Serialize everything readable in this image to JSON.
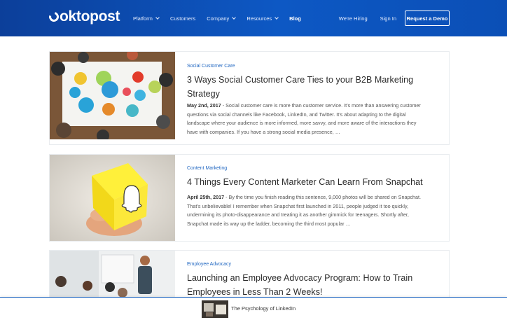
{
  "header": {
    "brand": "oktopost",
    "nav": [
      {
        "label": "Platform",
        "dropdown": true
      },
      {
        "label": "Customers",
        "dropdown": false
      },
      {
        "label": "Company",
        "dropdown": true
      },
      {
        "label": "Resources",
        "dropdown": true
      },
      {
        "label": "Blog",
        "dropdown": false,
        "active": true
      }
    ],
    "hiring": "We're Hiring",
    "sign_in": "Sign In",
    "demo": "Request a Demo"
  },
  "posts": [
    {
      "category": "Social Customer Care",
      "title_line1": "3 Ways Social Customer Care Ties to your B2B Marketing",
      "title_line2": "Strategy",
      "date": "May 2nd, 2017",
      "excerpt_l1": " - Social customer care is more than customer service. It’s more than answering customer",
      "excerpt_l2": "questions via social channels like Facebook, LinkedIn, and Twitter. It’s about adapting to the digital",
      "excerpt_l3": "landscape where your audience is more informed, more savvy, and more aware of the interactions they",
      "excerpt_l4": "have with companies. If you have a strong social media presence, …"
    },
    {
      "category": "Content Marketing",
      "title_line1": "4 Things Every Content Marketer Can Learn From Snapchat",
      "date": "April 25th, 2017",
      "excerpt_l1": " - By the time you finish reading this sentence, 9,000 photos will be shared on Snapchat.",
      "excerpt_l2": "That’s unbelievable! I remember when Snapchat first launched in 2011, people judged it too quickly,",
      "excerpt_l3": "undermining its photo-disappearance and treating it as another gimmick for teenagers. Shortly after,",
      "excerpt_l4": "Snapchat made its way up the ladder, becoming the third most popular …"
    },
    {
      "category": "Employee Advocacy",
      "title_line1": "Launching an Employee Advocacy Program: How to Train",
      "title_line2": "Employees in Less Than 2 Weeks!"
    }
  ],
  "footer": {
    "title": "The Psychology of LinkedIn"
  },
  "colors": {
    "brand_blue": "#0d58c4",
    "category_blue": "#1f66c1"
  }
}
